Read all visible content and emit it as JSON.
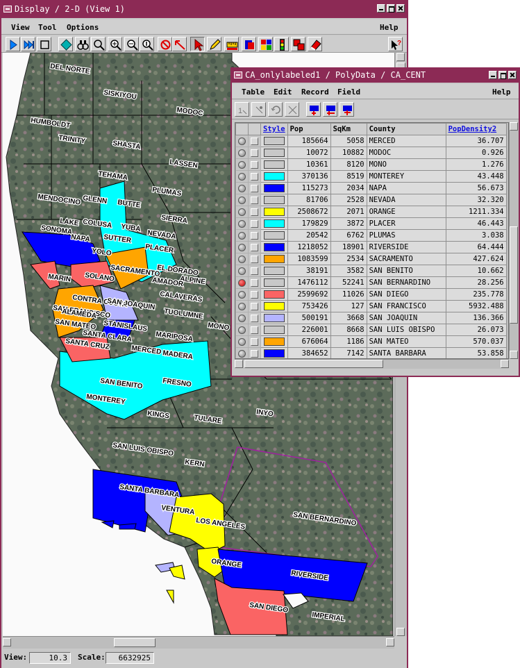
{
  "display": {
    "title": "Display / 2-D (View 1)",
    "menu": [
      "View",
      "Tool",
      "Options"
    ],
    "help": "Help",
    "tools": [
      "play-icon",
      "skip-forward-icon",
      "stop-icon",
      "diamond-icon",
      "binoculars-icon",
      "hand-zoom-icon",
      "zoom-in-icon",
      "zoom-out-icon",
      "zoom-one-icon",
      "no-select-icon",
      "red-arrow-icon",
      "pointer-icon",
      "pencil-icon",
      "ruler-icon",
      "layer-icon",
      "layers-color-icon",
      "traffic-light-icon",
      "stack-icon",
      "eraser-icon",
      "help-pointer-icon"
    ],
    "status": {
      "view_label": "View:",
      "view_value": "10.3",
      "scale_label": "Scale:",
      "scale_value": "6632925"
    }
  },
  "map": {
    "colors": {
      "cyan": "#00ffff",
      "blue": "#0000ff",
      "yellow": "#ffff00",
      "orange": "#ffa500",
      "salmon": "#fa6464",
      "lavender": "#b4b4ff",
      "terrain": "#5a6a58",
      "boundary": "#000000",
      "highlight": "#a020a0"
    },
    "labels": [
      {
        "name": "DEL NORTE"
      },
      {
        "name": "SISKIYOU"
      },
      {
        "name": "MODOC"
      },
      {
        "name": "HUMBOLDT"
      },
      {
        "name": "TRINITY"
      },
      {
        "name": "SHASTA"
      },
      {
        "name": "LASSEN"
      },
      {
        "name": "TEHAMA"
      },
      {
        "name": "PLUMAS"
      },
      {
        "name": "GLENN"
      },
      {
        "name": "BUTTE"
      },
      {
        "name": "MENDOCINO"
      },
      {
        "name": "SIERRA"
      },
      {
        "name": "LAKE"
      },
      {
        "name": "COLUSA"
      },
      {
        "name": "YUBA"
      },
      {
        "name": "NEVADA"
      },
      {
        "name": "SUTTER"
      },
      {
        "name": "PLACER"
      },
      {
        "name": "SONOMA"
      },
      {
        "name": "NAPA"
      },
      {
        "name": "YOLO"
      },
      {
        "name": "SACRAMENTO"
      },
      {
        "name": "EL DORADO"
      },
      {
        "name": "ALPINE"
      },
      {
        "name": "MARIN"
      },
      {
        "name": "SOLANO"
      },
      {
        "name": "AMADOR"
      },
      {
        "name": "CONTRA COSTA"
      },
      {
        "name": "CALAVERAS"
      },
      {
        "name": "SAN FRANCISCO"
      },
      {
        "name": "SAN JOAQUIN"
      },
      {
        "name": "TUOLUMNE"
      },
      {
        "name": "ALAMEDA"
      },
      {
        "name": "MONO"
      },
      {
        "name": "SAN MATEO"
      },
      {
        "name": "STANISLAUS"
      },
      {
        "name": "MARIPOSA"
      },
      {
        "name": "SANTA CLARA"
      },
      {
        "name": "MERCED"
      },
      {
        "name": "SANTA CRUZ"
      },
      {
        "name": "MADERA"
      },
      {
        "name": "SAN BENITO"
      },
      {
        "name": "FRESNO"
      },
      {
        "name": "MONTEREY"
      },
      {
        "name": "INYO"
      },
      {
        "name": "KINGS"
      },
      {
        "name": "TULARE"
      },
      {
        "name": "SAN LUIS OBISPO"
      },
      {
        "name": "KERN"
      },
      {
        "name": "SANTA BARBARA"
      },
      {
        "name": "VENTURA"
      },
      {
        "name": "LOS ANGELES"
      },
      {
        "name": "SAN BERNARDINO"
      },
      {
        "name": "ORANGE"
      },
      {
        "name": "RIVERSIDE"
      },
      {
        "name": "SAN DIEGO"
      },
      {
        "name": "IMPERIAL"
      }
    ]
  },
  "table": {
    "title": "CA_onlylabeled1 / PolyData / CA_CENT",
    "menu": [
      "Table",
      "Edit",
      "Record",
      "Field"
    ],
    "help": "Help",
    "tools": [
      "record-one-icon",
      "record-star-icon",
      "undo-record-icon",
      "record-cross-icon",
      "table-view-icon",
      "table-sort-icon",
      "table-star-icon"
    ],
    "columns": [
      "Style",
      "Pop",
      "SqKm",
      "County",
      "PopDensity2"
    ],
    "rows": [
      {
        "color": "#c8c8c8",
        "pop": "185664",
        "sqkm": "5058",
        "county": "MERCED",
        "density": "36.707",
        "selected": false
      },
      {
        "color": "#c8c8c8",
        "pop": "10072",
        "sqkm": "10882",
        "county": "MODOC",
        "density": "0.926",
        "selected": false
      },
      {
        "color": "#c8c8c8",
        "pop": "10361",
        "sqkm": "8120",
        "county": "MONO",
        "density": "1.276",
        "selected": false
      },
      {
        "color": "#00ffff",
        "pop": "370136",
        "sqkm": "8519",
        "county": "MONTEREY",
        "density": "43.448",
        "selected": false
      },
      {
        "color": "#0000ff",
        "pop": "115273",
        "sqkm": "2034",
        "county": "NAPA",
        "density": "56.673",
        "selected": false
      },
      {
        "color": "#c8c8c8",
        "pop": "81706",
        "sqkm": "2528",
        "county": "NEVADA",
        "density": "32.320",
        "selected": false
      },
      {
        "color": "#ffff00",
        "pop": "2508672",
        "sqkm": "2071",
        "county": "ORANGE",
        "density": "1211.334",
        "selected": false
      },
      {
        "color": "#00ffff",
        "pop": "179829",
        "sqkm": "3872",
        "county": "PLACER",
        "density": "46.443",
        "selected": false
      },
      {
        "color": "#c8c8c8",
        "pop": "20542",
        "sqkm": "6762",
        "county": "PLUMAS",
        "density": "3.038",
        "selected": false
      },
      {
        "color": "#0000ff",
        "pop": "1218052",
        "sqkm": "18901",
        "county": "RIVERSIDE",
        "density": "64.444",
        "selected": false
      },
      {
        "color": "#ffa500",
        "pop": "1083599",
        "sqkm": "2534",
        "county": "SACRAMENTO",
        "density": "427.624",
        "selected": false
      },
      {
        "color": "#c8c8c8",
        "pop": "38191",
        "sqkm": "3582",
        "county": "SAN BENITO",
        "density": "10.662",
        "selected": false
      },
      {
        "color": "#c8c8c8",
        "pop": "1476112",
        "sqkm": "52241",
        "county": "SAN BERNARDINO",
        "density": "28.256",
        "selected": true
      },
      {
        "color": "#fa6464",
        "pop": "2599692",
        "sqkm": "11026",
        "county": "SAN DIEGO",
        "density": "235.778",
        "selected": false
      },
      {
        "color": "#ffff00",
        "pop": "753426",
        "sqkm": "127",
        "county": "SAN FRANCISCO",
        "density": "5932.488",
        "selected": false
      },
      {
        "color": "#b4b4ff",
        "pop": "500191",
        "sqkm": "3668",
        "county": "SAN JOAQUIN",
        "density": "136.366",
        "selected": false
      },
      {
        "color": "#c8c8c8",
        "pop": "226001",
        "sqkm": "8668",
        "county": "SAN LUIS OBISPO",
        "density": "26.073",
        "selected": false
      },
      {
        "color": "#ffa500",
        "pop": "676064",
        "sqkm": "1186",
        "county": "SAN MATEO",
        "density": "570.037",
        "selected": false
      },
      {
        "color": "#0000ff",
        "pop": "384652",
        "sqkm": "7142",
        "county": "SANTA BARBARA",
        "density": "53.858",
        "selected": false
      }
    ]
  }
}
